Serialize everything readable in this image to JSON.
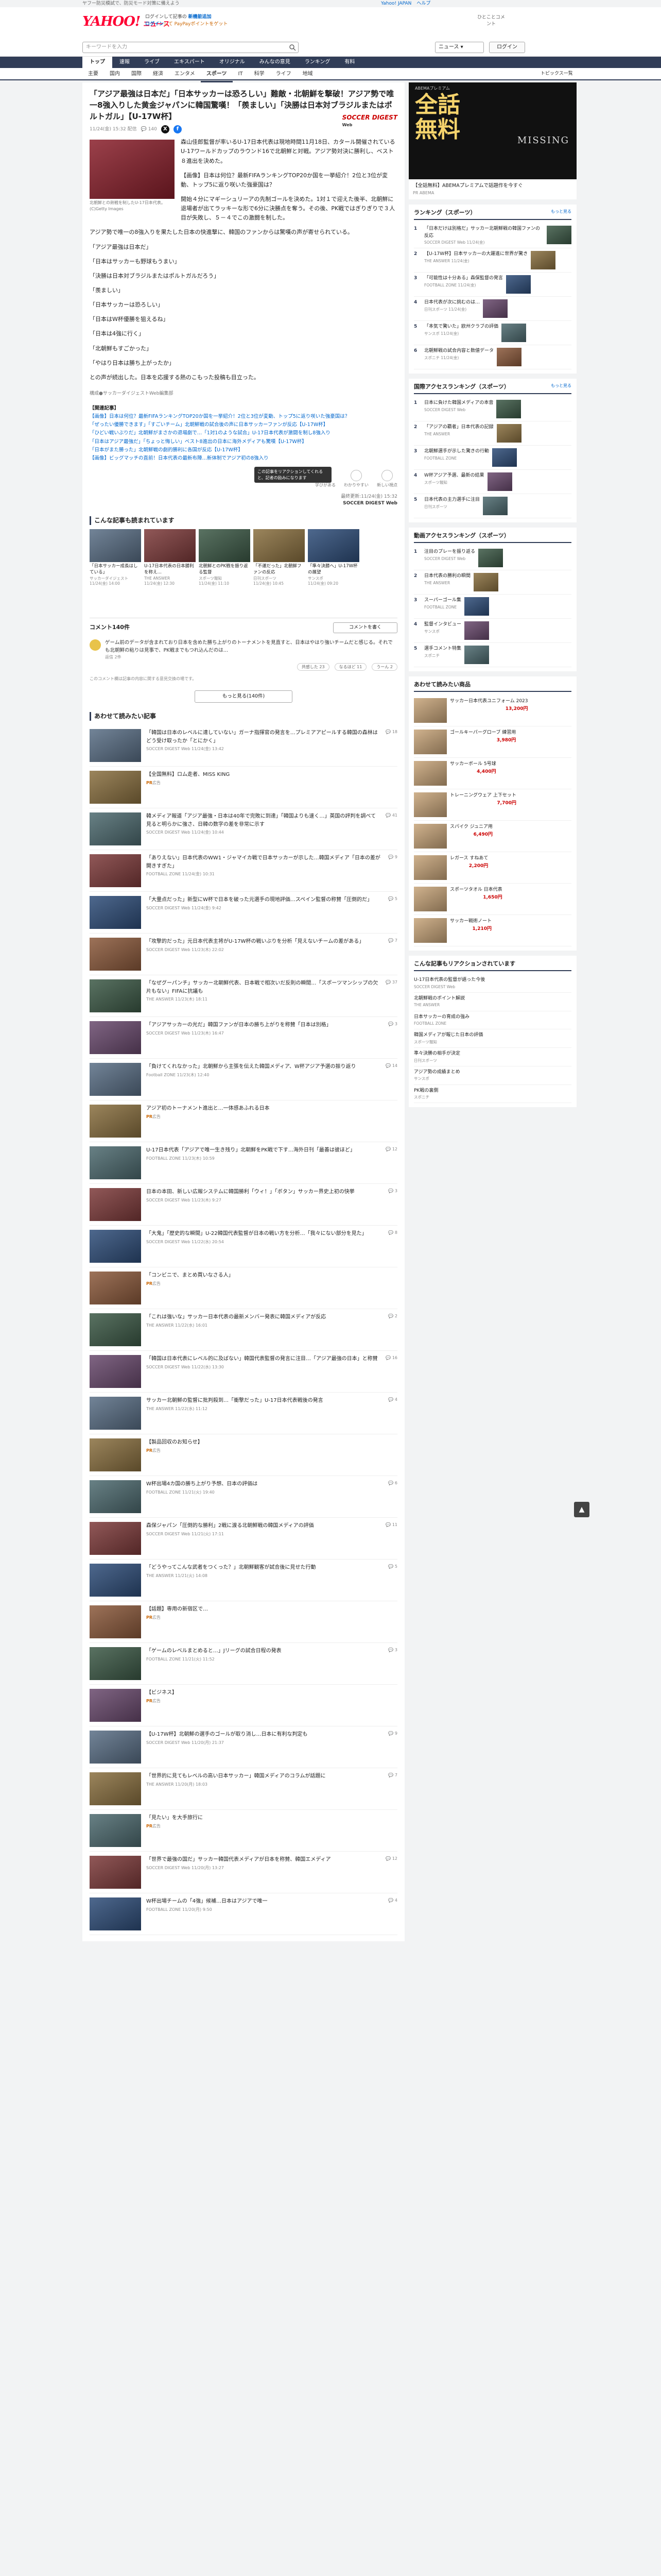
{
  "util": {
    "left": "ヤフー防災模試で、防災モード対策に備えよう",
    "right": [
      "Yahoo! JAPAN",
      "ヘルプ"
    ]
  },
  "header": {
    "logo_yahoo": "YAHOO!",
    "logo_sub": "JAPAN",
    "logo_news": "ニュース",
    "line1": "ログインして記事の",
    "line1_link": "新機能追加",
    "line2": "ログイン",
    "line2_pt": "して PayPayポイントをゲット",
    "right": "ひとことコメント"
  },
  "search": {
    "placeholder": "キーワードを入力",
    "select": "ニュース",
    "login": "ログイン"
  },
  "gnav": [
    "トップ",
    "速報",
    "ライブ",
    "エキスパート",
    "オリジナル",
    "みんなの意見",
    "ランキング",
    "有料"
  ],
  "snav": [
    "主要",
    "国内",
    "国際",
    "経済",
    "エンタメ",
    "スポーツ",
    "IT",
    "科学",
    "ライフ",
    "地域"
  ],
  "snav_topics": "トピックス一覧",
  "article": {
    "title": "「アジア最強は日本だ」「日本サッカーは恐ろしい」難敵・北朝鮮を撃破！アジア勢で唯一8強入りした黄金ジャパンに韓国驚嘆！「羨ましい」「決勝は日本対ブラジルまたはポルトガル」【U-17W杯】",
    "date": "11/24(金) 15:32 配信",
    "comments": "140",
    "publisher": "SOCCER DIGEST",
    "publisher_sub": "Web",
    "caption": "北朝鮮との熱戦を制したU-17日本代表。(C)Getty Images",
    "paragraphs": [
      "森山佳郎監督が率いるU-17日本代表は現地時間11月18日、カタール開催されているU-17ワールドカップのラウンド16で北朝鮮と対戦。アジア勢対決に勝利し、ベスト８進出を決めた。",
      "【画像】日本は何位？最新FIFAランキングTOP20か国を一挙紹介！2位と3位が変動、トップ5に返り咲いた強豪国は？",
      "開始４分にマギーシュリーアの先制ゴールを決めた。1対１で迎えた後半、北朝鮮に退場者が出てラッキーな形で6分に決勝点を奪う。その後、PK戦ではぎりぎりで３人目が失敗し、５－４でこの激闘を制した。",
      "アジア勢で唯一の8強入りを果たした日本の快進撃に、韓国のファンからは驚嘆の声が寄せられている。",
      "「アジア最強は日本だ」",
      "「日本はサッカーも野球もうまい」",
      "「決勝は日本対ブラジルまたはポルトガルだろう」",
      "「羨ましい」",
      "「日本サッカーは恐ろしい」",
      "「日本はW杯優勝を狙えるね」",
      "「日本は4強に行く」",
      "「北朝鮮もすごかった」",
      "「やはり日本は勝ち上がったか」",
      "との声が続出した。日本を応援する熱のこもった投稿も目立った。"
    ],
    "tags": "構成●サッカーダイジェストWeb編集部",
    "related_head": "【関連記事】",
    "related": [
      "【画像】日本は何位？最新FIFAランキングTOP20か国を一挙紹介！2位と3位が変動、トップ5に返り咲いた強豪国は？",
      "「ぜったい優勝できます」「すごいチーム」北朝鮮戦の試合後の声に日本サッカーファンが反応【U-17W杯】",
      "「ひどい戦いぶりだ」北朝鮮がまさかの退場劇で…「1対1のような試合」U-17日本代表が激闘を制し8強入り",
      "「日本はアジア最強だ」「ちょっと悔しい」ベスト8進出の日本に海外メディアも驚嘆【U-17W杯】",
      "「日本がまた勝った」北朝鮮戦の劇的勝利に各国が反応【U-17W杯】",
      "【画像】ビッグマッチの直前！日本代表の最新布陣…新体制でアジア初の8強入り"
    ],
    "reactions": [
      "学びがある",
      "わかりやすい",
      "新しい視点"
    ],
    "tooltip": "この記事をリアクションしてくれると、記者の励みになります",
    "source_date": "最終更新:11/24(金) 15:32",
    "source_name": "SOCCER DIGEST Web"
  },
  "recs": {
    "title": "こんな記事も読まれています",
    "items": [
      {
        "title": "「日本サッカー成長はしている」",
        "src": "サッカーダイジェスト",
        "time": "11/24(金) 14:00"
      },
      {
        "title": "U-17日本代表の日本勝利を称え…",
        "src": "THE ANSWER",
        "time": "11/24(金) 12:30"
      },
      {
        "title": "北朝鮮とのPK戦を振り返る監督",
        "src": "スポーツ報知",
        "time": "11/24(金) 11:10"
      },
      {
        "title": "「不運だった」北朝鮮ファンの反応",
        "src": "日刊スポーツ",
        "time": "11/24(金) 10:45"
      },
      {
        "title": "「準々決勝へ」U-17W杯の展望",
        "src": "サンスポ",
        "time": "11/24(金) 09:20"
      }
    ]
  },
  "comments": {
    "count_label": "コメント140件",
    "write": "コメントを書く",
    "first_text": "ゲーム前のデータが含まれており日本を含めた勝ち上がりのトーナメントを見直すと、日本はやはり強いチームだと感じる。それでも北朝鮮の粘りは見事で、PK戦までもつれ込んだのは…",
    "first_by": "返信 2件",
    "acts": [
      "共感した 23",
      "なるほど 11",
      "うーん 2"
    ],
    "more": "もっと見る(140件)",
    "notice": "このコメント欄は記事の内容に関する意見交換の場です。"
  },
  "feed": {
    "title": "あわせて読みたい記事",
    "items": [
      {
        "title": "「韓国は日本のレベルに達していない」ガーナ指揮官の発言を…プレミアアピールする韓国の森林はどう受け取ったか「とにかく」",
        "src": "SOCCER DIGEST Web",
        "time": "11/24(金) 13:42",
        "ct": "18"
      },
      {
        "title": "【全国無料】ロム走者、MISS KING",
        "src": "広告",
        "time": "",
        "ct": "",
        "pr": "PR"
      },
      {
        "title": "韓メディア報道「アジア最強・日本は40年で完敗に到達」「韓国よりも速く…」英国の評判を調べて見ると明らかに強さ、日韓の数字の差を非常に示す",
        "src": "SOCCER DIGEST Web",
        "time": "11/24(金) 10:44",
        "ct": "41"
      },
      {
        "title": "「ありえない」日本代表のWW1・ジャマイカ戦で日本サッカーが示した…韓国メディア「日本の差が開きすぎた」",
        "src": "FOOTBALL ZONE",
        "time": "11/24(金) 10:31",
        "ct": "9"
      },
      {
        "title": "「大量点だった」新型にW杯で日本を破った元選手の現地評価…スペイン監督の称賛「圧倒的だ」",
        "src": "SOCCER DIGEST Web",
        "time": "11/24(金) 9:42",
        "ct": "5"
      },
      {
        "title": "「攻撃的だった」元日本代表主将がU-17W杯の戦いぶりを分析「見えないチームの差がある」",
        "src": "SOCCER DIGEST Web",
        "time": "11/23(木) 22:02",
        "ct": "7"
      },
      {
        "title": "「なぜグーパンチ」サッカー北朝鮮代表、日本戦で相次いだ反則の瞬間…「スポーツマンシップの欠片もない」FIFAに抗議も",
        "src": "THE ANSWER",
        "time": "11/23(木) 18:11",
        "ct": "37"
      },
      {
        "title": "「アジアサッカーの光だ」韓国ファンが日本の勝ち上がりを称賛「日本は別格」",
        "src": "SOCCER DIGEST Web",
        "time": "11/23(木) 16:47",
        "ct": "3"
      },
      {
        "title": "「負けてくれなかった」北朝鮮から主張を伝えた韓国メディア、W杯アジア予選の振り返り",
        "src": "Football ZONE",
        "time": "11/23(木) 12:40",
        "ct": "14"
      },
      {
        "title": "アジア初のトーナメント進出と…一体感あふれる日本",
        "src": "広告",
        "time": "",
        "ct": "",
        "pr": "PR"
      },
      {
        "title": "U-17日本代表「アジアで唯一生き残り」北朝鮮をPK戦で下す…海外日刊「最善は彼ほど」",
        "src": "FOOTBALL ZONE",
        "time": "11/23(木) 10:59",
        "ct": "12"
      },
      {
        "title": "日本の本田、新しい広報システムに韓国勝利「ウィ！」「ボタン」サッカー界史上初の快挙",
        "src": "SOCCER DIGEST Web",
        "time": "11/23(木) 9:27",
        "ct": "3"
      },
      {
        "title": "「大鬼」「歴史的な瞬間」U-22韓国代表監督が日本の戦い方を分析…「我々にない部分を見た」",
        "src": "SOCCER DIGEST Web",
        "time": "11/22(水) 20:54",
        "ct": "8"
      },
      {
        "title": "「コンビニで、まとめ買いなさる人」",
        "src": "広告",
        "time": "",
        "ct": "",
        "pr": "PR"
      },
      {
        "title": "「これは強いな」サッカー日本代表の最新メンバー発表に韓国メディアが反応",
        "src": "THE ANSWER",
        "time": "11/22(水) 16:01",
        "ct": "2"
      },
      {
        "title": "「韓国は日本代表にレベル的に及ばない」韓国代表監督の発言に注目…「アジア最強の日本」と称賛",
        "src": "SOCCER DIGEST Web",
        "time": "11/22(水) 13:30",
        "ct": "16"
      },
      {
        "title": "サッカー北朝鮮の監督に批判殺到…「衝撃だった」U-17日本代表戦後の発言",
        "src": "THE ANSWER",
        "time": "11/22(水) 11:12",
        "ct": "4"
      },
      {
        "title": "【製品回収のお知らせ】",
        "src": "広告",
        "time": "",
        "ct": "",
        "pr": "PR"
      },
      {
        "title": "W杯出場4カ国の勝ち上がり予想、日本の評価は",
        "src": "FOOTBALL ZONE",
        "time": "11/21(火) 19:40",
        "ct": "6"
      },
      {
        "title": "森保ジャパン「圧倒的な勝利」2戦に渡る北朝鮮戦の韓国メディアの評価",
        "src": "SOCCER DIGEST Web",
        "time": "11/21(火) 17:11",
        "ct": "11"
      },
      {
        "title": "「どうやってこんな武者をつくった？」北朝鮮観客が試合後に見せた行動",
        "src": "THE ANSWER",
        "time": "11/21(火) 14:08",
        "ct": "5"
      },
      {
        "title": "【話題】専用の新宿区で…",
        "src": "広告",
        "time": "",
        "ct": "",
        "pr": "PR"
      },
      {
        "title": "「ゲームのレベルまとめると…」Jリーグの試合日程の発表",
        "src": "FOOTBALL ZONE",
        "time": "11/21(火) 11:52",
        "ct": "3"
      },
      {
        "title": "【ビジネス】",
        "src": "広告",
        "time": "",
        "ct": "",
        "pr": "PR"
      },
      {
        "title": "【U-17W杯】北朝鮮の選手のゴールが取り消し…日本に有利な判定も",
        "src": "SOCCER DIGEST Web",
        "time": "11/20(月) 21:37",
        "ct": "9"
      },
      {
        "title": "「世界的に見てもレベルの高い日本サッカー」韓国メディアのコラムが話題に",
        "src": "THE ANSWER",
        "time": "11/20(月) 18:03",
        "ct": "7"
      },
      {
        "title": "「見たい」を大手旅行に",
        "src": "広告",
        "time": "",
        "ct": "",
        "pr": "PR"
      },
      {
        "title": "「世界で最強の国だ」サッカー韓国代表メディアが日本を称賛、韓国エメディア",
        "src": "SOCCER DIGEST Web",
        "time": "11/20(月) 13:27",
        "ct": "12"
      },
      {
        "title": "W杯出場チームの「4強」候補…日本はアジアで唯一",
        "src": "FOOTBALL ZONE",
        "time": "11/20(月) 9:50",
        "ct": "4"
      }
    ]
  },
  "ad": {
    "tag": "ABEMAプレミアム",
    "big1": "全話",
    "big2": "無料",
    "name": "MISSING",
    "text": "【全話無料】ABEMAプレミアムで話題作を今すぐ",
    "pr": "PR ABEMA"
  },
  "ranking": {
    "title": "ランキング（スポーツ）",
    "link": "もっと見る",
    "items": [
      {
        "title": "「日本だけは別格だ」サッカー北朝鮮戦の韓国ファンの反応",
        "src": "SOCCER DIGEST Web 11/24(金)"
      },
      {
        "title": "【U-17W杯】日本サッカーの大躍進に世界が驚き",
        "src": "THE ANSWER 11/24(金)"
      },
      {
        "title": "「可能性は十分ある」森保監督の発言",
        "src": "FOOTBALL ZONE 11/24(金)"
      },
      {
        "title": "日本代表が次に挑むのは…",
        "src": "日刊スポーツ 11/24(金)"
      },
      {
        "title": "「本気で驚いた」欧州クラブの評価",
        "src": "サンスポ 11/24(金)"
      },
      {
        "title": "北朝鮮戦の試合内容と数値データ",
        "src": "スポニチ 11/24(金)"
      }
    ]
  },
  "access": {
    "title": "国際アクセスランキング（スポーツ）",
    "link": "もっと見る",
    "items": [
      {
        "title": "日本に負けた韓国メディアの本音",
        "src": "SOCCER DIGEST Web"
      },
      {
        "title": "「アジアの覇者」日本代表の記録",
        "src": "THE ANSWER"
      },
      {
        "title": "北朝鮮選手が示した驚きの行動",
        "src": "FOOTBALL ZONE"
      },
      {
        "title": "W杯アジア予選、最新の結果",
        "src": "スポーツ報知"
      },
      {
        "title": "日本代表の主力選手に注目",
        "src": "日刊スポーツ"
      }
    ]
  },
  "news_rank": {
    "title": "動画アクセスランキング（スポーツ）",
    "items": [
      {
        "title": "注目のプレーを振り返る",
        "src": "SOCCER DIGEST Web"
      },
      {
        "title": "日本代表の勝利の瞬間",
        "src": "THE ANSWER"
      },
      {
        "title": "スーパーゴール集",
        "src": "FOOTBALL ZONE"
      },
      {
        "title": "監督インタビュー",
        "src": "サンスポ"
      },
      {
        "title": "選手コメント特集",
        "src": "スポニチ"
      }
    ]
  },
  "shop": {
    "title": "あわせて読みたい商品",
    "items": [
      {
        "title": "サッカー日本代表ユニフォーム 2023",
        "price": "13,200円"
      },
      {
        "title": "ゴールキーパーグローブ 練習用",
        "price": "3,980円"
      },
      {
        "title": "サッカーボール 5号球",
        "price": "4,400円"
      },
      {
        "title": "トレーニングウェア 上下セット",
        "price": "7,700円"
      },
      {
        "title": "スパイク ジュニア用",
        "price": "6,490円"
      },
      {
        "title": "レガース すねあて",
        "price": "2,200円"
      },
      {
        "title": "スポーツタオル 日本代表",
        "price": "1,650円"
      },
      {
        "title": "サッカー戦術ノート",
        "price": "1,210円"
      }
    ]
  },
  "people": {
    "title": "こんな記事もリアクションされています",
    "items": [
      {
        "title": "U-17日本代表の監督が語った今後",
        "src": "SOCCER DIGEST Web"
      },
      {
        "title": "北朝鮮戦のポイント解説",
        "src": "THE ANSWER"
      },
      {
        "title": "日本サッカーの育成の強み",
        "src": "FOOTBALL ZONE"
      },
      {
        "title": "韓国メディアが報じた日本の評価",
        "src": "スポーツ報知"
      },
      {
        "title": "準々決勝の相手が決定",
        "src": "日刊スポーツ"
      },
      {
        "title": "アジア勢の成績まとめ",
        "src": "サンスポ"
      },
      {
        "title": "PK戦の裏側",
        "src": "スポニチ"
      }
    ]
  }
}
